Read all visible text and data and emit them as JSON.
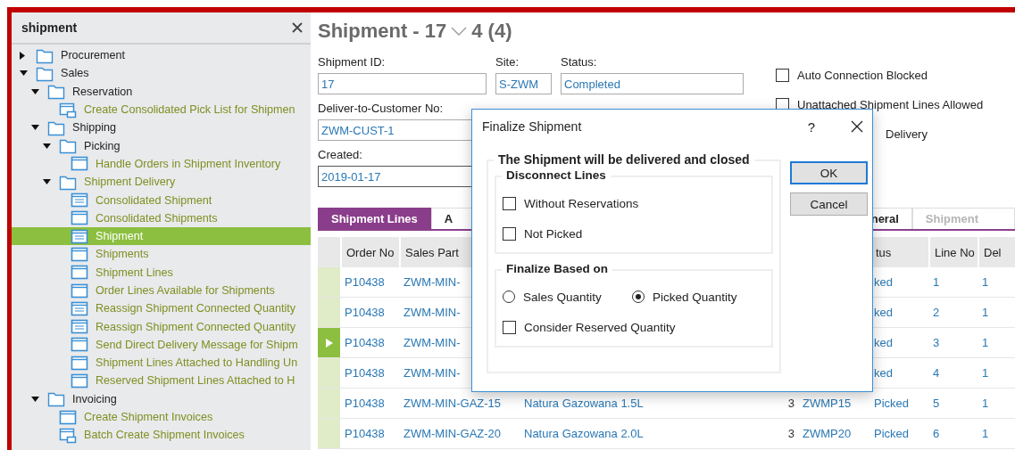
{
  "sidebar": {
    "title": "shipment",
    "tree": [
      {
        "kind": "folder",
        "label": "Procurement",
        "expanded": false,
        "selected": false
      },
      {
        "kind": "folder",
        "label": "Sales",
        "expanded": true,
        "selected": false,
        "children": [
          {
            "kind": "folder",
            "label": "Reservation",
            "expanded": true,
            "selected": false,
            "children": [
              {
                "kind": "batch",
                "label": "Create Consolidated Pick List for Shipmen",
                "selected": false
              }
            ]
          },
          {
            "kind": "folder",
            "label": "Shipping",
            "expanded": true,
            "selected": false,
            "children": [
              {
                "kind": "folder",
                "label": "Picking",
                "expanded": true,
                "selected": false,
                "children": [
                  {
                    "kind": "window",
                    "label": "Handle Orders in Shipment Inventory",
                    "selected": false
                  }
                ]
              },
              {
                "kind": "page-folder",
                "label": "Shipment Delivery",
                "expanded": true,
                "selected": false,
                "children": [
                  {
                    "kind": "list",
                    "label": "Consolidated Shipment",
                    "selected": false
                  },
                  {
                    "kind": "window",
                    "label": "Consolidated Shipments",
                    "selected": false
                  },
                  {
                    "kind": "list",
                    "label": "Shipment",
                    "selected": true
                  },
                  {
                    "kind": "window",
                    "label": "Shipments",
                    "selected": false
                  },
                  {
                    "kind": "window",
                    "label": "Shipment Lines",
                    "selected": false
                  },
                  {
                    "kind": "window",
                    "label": "Order Lines Available for Shipments",
                    "selected": false
                  },
                  {
                    "kind": "list",
                    "label": "Reassign Shipment Connected Quantity",
                    "selected": false
                  },
                  {
                    "kind": "list",
                    "label": "Reassign Shipment Connected Quantity",
                    "selected": false
                  },
                  {
                    "kind": "window",
                    "label": "Send Direct Delivery Message for Shipm",
                    "selected": false
                  },
                  {
                    "kind": "window",
                    "label": "Shipment Lines Attached to Handling Un",
                    "selected": false
                  },
                  {
                    "kind": "window",
                    "label": "Reserved Shipment Lines Attached to H",
                    "selected": false
                  }
                ]
              }
            ]
          },
          {
            "kind": "folder",
            "label": "Invoicing",
            "expanded": true,
            "selected": false,
            "children": [
              {
                "kind": "window",
                "label": "Create Shipment Invoices",
                "selected": false
              },
              {
                "kind": "batch",
                "label": "Batch Create Shipment Invoices",
                "selected": false
              }
            ]
          }
        ]
      }
    ]
  },
  "page": {
    "title": "Shipment - 17",
    "record": "4 (4)"
  },
  "fields": [
    {
      "label": "Shipment ID:",
      "value": "17"
    },
    {
      "label": "Site:",
      "value": "S-ZWM"
    },
    {
      "label": "Status:",
      "value": "Completed"
    },
    {
      "label": "Deliver-to-Customer No:",
      "value": "ZWM-CUST-1"
    },
    {
      "label": "Created:",
      "value": "2019-01-17"
    }
  ],
  "options": [
    {
      "kind": "checkbox",
      "label": "Auto Connection Blocked",
      "checked": false
    },
    {
      "kind": "checkbox",
      "label": "Unattached Shipment Lines Allowed",
      "checked": false
    },
    {
      "kind": "label",
      "label": "Delivery"
    }
  ],
  "tabs": [
    {
      "label": "Shipment Lines",
      "selected": true,
      "disabled": false
    },
    {
      "label": "A",
      "selected": false,
      "disabled": false
    },
    {
      "label": "neral",
      "selected": false,
      "disabled": false
    },
    {
      "label": "Shipment",
      "selected": false,
      "disabled": true
    }
  ],
  "table": {
    "columns": {
      "order_no": "Order No",
      "sales_part_no": "Sales Part",
      "status": "tus",
      "line_no": "Line No",
      "del_no": "Del"
    },
    "rows": [
      {
        "selected": false,
        "order_no": "P10438",
        "sales_part_no": "ZWM-MIN-",
        "status": "ked",
        "line_no": "1",
        "del_no": "1"
      },
      {
        "selected": false,
        "order_no": "P10438",
        "sales_part_no": "ZWM-MIN-",
        "status": "ked",
        "line_no": "2",
        "del_no": "1"
      },
      {
        "selected": true,
        "order_no": "P10438",
        "sales_part_no": "ZWM-MIN-",
        "status": "ked",
        "line_no": "3",
        "del_no": "1"
      },
      {
        "selected": false,
        "order_no": "P10438",
        "sales_part_no": "ZWM-MIN-",
        "status": "ked",
        "line_no": "4",
        "del_no": "1"
      },
      {
        "selected": false,
        "order_no": "P10438",
        "sales_part_no": "ZWM-MIN-GAZ-15",
        "column_3": "Natura Gazowana 1.5L",
        "column_4": "3",
        "column_5": "ZWMP15",
        "status": "Picked",
        "line_no": "5",
        "del_no": "1"
      },
      {
        "selected": false,
        "order_no": "P10438",
        "sales_part_no": "ZWM-MIN-GAZ-20",
        "column_3": "Natura Gazowana 2.0L",
        "column_4": "3",
        "column_5": "ZWMP20",
        "status": "Picked",
        "line_no": "6",
        "del_no": "1"
      }
    ]
  },
  "dialog": {
    "title": "Finalize Shipment",
    "help": "?",
    "group": "The Shipment will be delivered and closed",
    "sections": [
      {
        "title": "Disconnect Lines",
        "options": [
          {
            "kind": "checkbox",
            "label": "Without Reservations",
            "checked": false
          },
          {
            "kind": "checkbox",
            "label": "Not Picked",
            "checked": false
          }
        ]
      },
      {
        "title": "Finalize Based on",
        "options": [
          {
            "kind": "radio",
            "label": "Sales Quantity",
            "selected": false
          },
          {
            "kind": "radio",
            "label": "Picked Quantity",
            "selected": true
          },
          {
            "kind": "checkbox",
            "label": "Consider Reserved Quantity",
            "checked": false
          }
        ]
      }
    ],
    "buttons": [
      {
        "label": "OK",
        "default": true
      },
      {
        "label": "Cancel",
        "default": false
      }
    ]
  }
}
